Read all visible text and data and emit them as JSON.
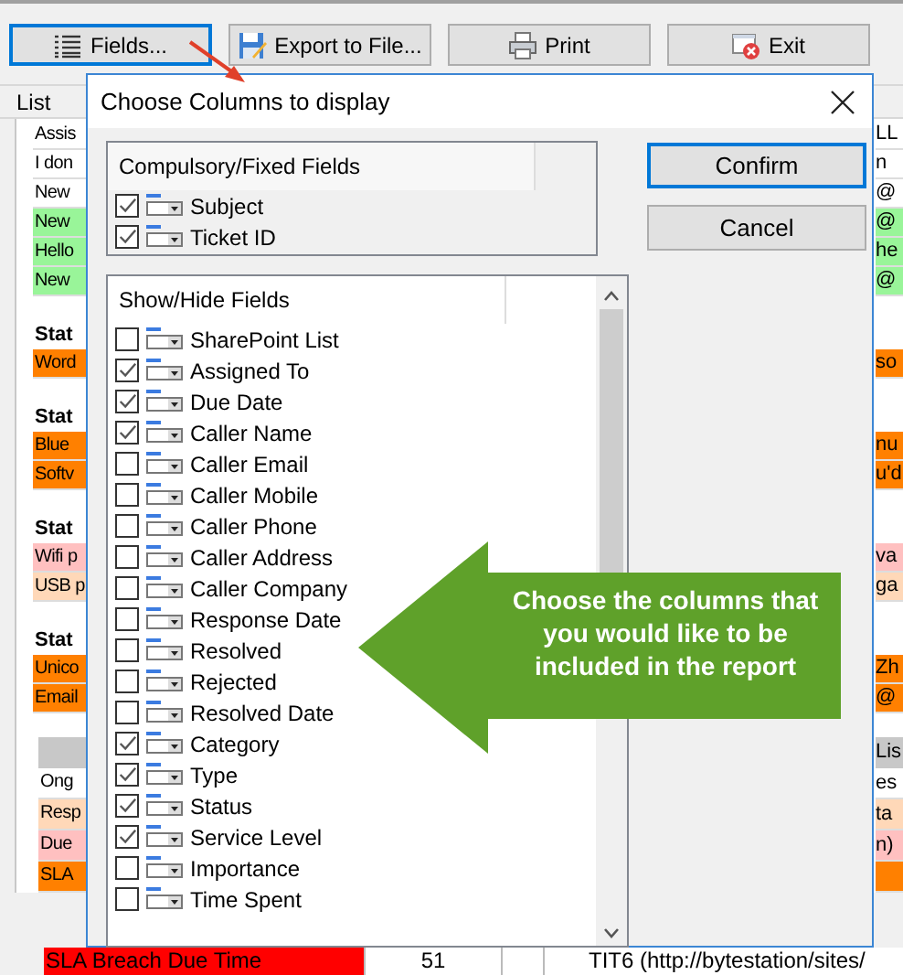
{
  "toolbar": {
    "buttons": [
      {
        "label": "Fields...",
        "kind": "lines",
        "focused": true
      },
      {
        "label": "Export to File...",
        "kind": "disk",
        "focused": false
      },
      {
        "label": "Print",
        "kind": "printer",
        "focused": false
      },
      {
        "label": "Exit",
        "kind": "exit",
        "focused": false
      }
    ]
  },
  "list": {
    "header": "List",
    "groups": [
      {
        "rows": [
          {
            "left": "Assis",
            "right": "LL",
            "color": "#ffffff"
          },
          {
            "left": "I don",
            "right": "n",
            "color": "#ffffff"
          },
          {
            "left": "New",
            "right": "@",
            "color": "#ffffff"
          },
          {
            "left": "New",
            "right": "@",
            "color": "#99f599"
          },
          {
            "left": "Hello",
            "right": "he",
            "color": "#99f599"
          },
          {
            "left": "New",
            "right": "@",
            "color": "#99f599"
          }
        ]
      },
      {
        "heading": "Stat",
        "rows": [
          {
            "left": "Word",
            "right": "so",
            "color": "#ff8000"
          }
        ]
      },
      {
        "heading": "Stat",
        "rows": [
          {
            "left": "Blue",
            "right": "nu",
            "color": "#ff8000"
          },
          {
            "left": "Softv",
            "right": "u'd",
            "color": "#ff8000"
          }
        ]
      },
      {
        "heading": "Stat",
        "rows": [
          {
            "left": "Wifi p",
            "right": "va",
            "color": "#ffc0c0"
          },
          {
            "left": "USB p",
            "right": "ga",
            "color": "#ffd8b8"
          }
        ]
      },
      {
        "heading": "Stat",
        "rows": [
          {
            "left": "Unico",
            "right": "Zh",
            "color": "#ff8000"
          },
          {
            "left": "Email",
            "right": "@",
            "color": "#ff8000"
          }
        ]
      }
    ]
  },
  "legend": {
    "header": "Lis",
    "rows": [
      {
        "left": "Ong",
        "right": "es",
        "color": "#ffffff"
      },
      {
        "left": "Resp",
        "right": "ta",
        "color": "#ffd8b8"
      },
      {
        "left": "Due",
        "right": "n)",
        "color": "#ffc0c0"
      },
      {
        "left": "SLA",
        "right": "",
        "color": "#ff8000"
      }
    ],
    "bottom_row": {
      "label": "SLA Breach Due Time",
      "count": "51",
      "link": "TIT6 (http://bytestation/sites/",
      "color": "#ff0000"
    }
  },
  "dialog": {
    "title": "Choose Columns to display",
    "compulsory": {
      "header": "Compulsory/Fixed Fields",
      "items": [
        {
          "label": "Subject",
          "checked": true
        },
        {
          "label": "Ticket ID",
          "checked": true
        }
      ]
    },
    "show_hide": {
      "header": "Show/Hide Fields",
      "items": [
        {
          "label": "SharePoint List",
          "checked": false
        },
        {
          "label": "Assigned To",
          "checked": true
        },
        {
          "label": "Due Date",
          "checked": true
        },
        {
          "label": "Caller Name",
          "checked": true
        },
        {
          "label": "Caller Email",
          "checked": false
        },
        {
          "label": "Caller Mobile",
          "checked": false
        },
        {
          "label": "Caller Phone",
          "checked": false
        },
        {
          "label": "Caller Address",
          "checked": false
        },
        {
          "label": "Caller Company",
          "checked": false
        },
        {
          "label": "Response Date",
          "checked": false
        },
        {
          "label": "Resolved",
          "checked": false
        },
        {
          "label": "Rejected",
          "checked": false
        },
        {
          "label": "Resolved Date",
          "checked": false
        },
        {
          "label": "Category",
          "checked": true
        },
        {
          "label": "Type",
          "checked": true
        },
        {
          "label": "Status",
          "checked": true
        },
        {
          "label": "Service Level",
          "checked": true
        },
        {
          "label": "Importance",
          "checked": false
        },
        {
          "label": "Time Spent",
          "checked": false
        }
      ]
    },
    "buttons": [
      {
        "label": "Confirm",
        "default": true
      },
      {
        "label": "Cancel",
        "default": false
      }
    ]
  },
  "callout": {
    "text": "Choose the columns that you would like to be included in the report"
  }
}
